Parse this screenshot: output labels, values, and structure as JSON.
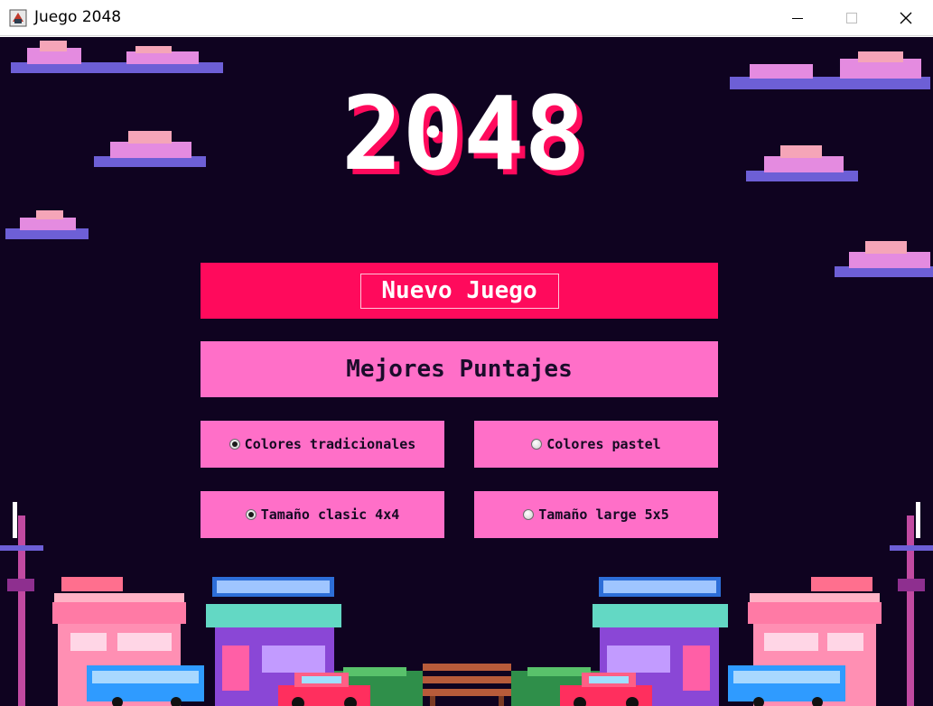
{
  "window": {
    "title": "Juego 2048",
    "icon": "java-app-icon",
    "controls": [
      "minimize-icon",
      "maximize-icon",
      "close-icon"
    ]
  },
  "logo": {
    "text": "2048"
  },
  "menu": {
    "new_game": "Nuevo Juego",
    "best_scores": "Mejores Puntajes"
  },
  "options": {
    "color_traditional": {
      "label": "Colores tradicionales",
      "selected": true
    },
    "color_pastel": {
      "label": "Colores pastel",
      "selected": false
    },
    "size_classic": {
      "label": "Tamaño clasic 4x4",
      "selected": true
    },
    "size_large": {
      "label": "Tamaño large 5x5",
      "selected": false
    }
  },
  "colors": {
    "background": "#0f0320",
    "primary_button": "#ff0a5c",
    "secondary_button": "#ff6fc8",
    "logo_shadow": "#ff0a5c"
  }
}
